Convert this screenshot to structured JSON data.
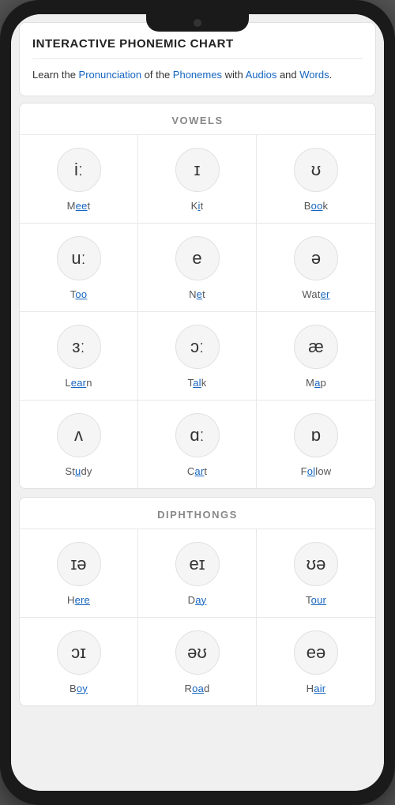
{
  "app": {
    "title": "INTERACTIVE PHONEMIC CHART",
    "subtitle_parts": [
      {
        "text": "Learn the Pronunciation of the Phonemes with Audios and Words.",
        "highlight_words": [
          "Pronunciation",
          "Phonemes",
          "Audios",
          "Words"
        ]
      }
    ],
    "subtitle_display": "Learn the {Pronunciation} of the {Phonemes} with {Audios} and {Words}."
  },
  "sections": [
    {
      "id": "vowels",
      "title": "VOWELS",
      "cells": [
        {
          "symbol": "iː",
          "word_before": "M",
          "word_highlight": "ee",
          "word_after": "t",
          "full_word": "Meet",
          "last_row": false
        },
        {
          "symbol": "ɪ",
          "word_before": "K",
          "word_highlight": "i",
          "word_after": "t",
          "full_word": "Kit",
          "last_row": false
        },
        {
          "symbol": "ʊ",
          "word_before": "B",
          "word_highlight": "oo",
          "word_after": "k",
          "full_word": "Book",
          "last_row": false
        },
        {
          "symbol": "uː",
          "word_before": "T",
          "word_highlight": "oo",
          "word_after": "",
          "full_word": "Too",
          "last_row": false
        },
        {
          "symbol": "e",
          "word_before": "N",
          "word_highlight": "e",
          "word_after": "t",
          "full_word": "Net",
          "last_row": false
        },
        {
          "symbol": "ə",
          "word_before": "Wat",
          "word_highlight": "er",
          "word_after": "",
          "full_word": "Water",
          "last_row": false
        },
        {
          "symbol": "ɜː",
          "word_before": "L",
          "word_highlight": "ear",
          "word_after": "n",
          "full_word": "Learn",
          "last_row": false
        },
        {
          "symbol": "ɔː",
          "word_before": "T",
          "word_highlight": "al",
          "word_after": "k",
          "full_word": "Talk",
          "last_row": false
        },
        {
          "symbol": "æ",
          "word_before": "M",
          "word_highlight": "a",
          "word_after": "p",
          "full_word": "Map",
          "last_row": false
        },
        {
          "symbol": "ʌ",
          "word_before": "St",
          "word_highlight": "u",
          "word_after": "dy",
          "full_word": "Study",
          "last_row": true
        },
        {
          "symbol": "ɑː",
          "word_before": "C",
          "word_highlight": "ar",
          "word_after": "t",
          "full_word": "Cart",
          "last_row": true
        },
        {
          "symbol": "ɒ",
          "word_before": "F",
          "word_highlight": "ol",
          "word_after": "low",
          "full_word": "Follow",
          "last_row": true
        }
      ]
    },
    {
      "id": "diphthongs",
      "title": "DIPHTHONGS",
      "cells": [
        {
          "symbol": "ɪə",
          "word_before": "H",
          "word_highlight": "ere",
          "word_after": "",
          "full_word": "Here",
          "last_row": false
        },
        {
          "symbol": "eɪ",
          "word_before": "D",
          "word_highlight": "ay",
          "word_after": "",
          "full_word": "Day",
          "last_row": false
        },
        {
          "symbol": "ʊə",
          "word_before": "T",
          "word_highlight": "our",
          "word_after": "",
          "full_word": "Tour",
          "last_row": false
        },
        {
          "symbol": "ɔɪ",
          "word_before": "B",
          "word_highlight": "oy",
          "word_after": "",
          "full_word": "Boy",
          "last_row": true
        },
        {
          "symbol": "əʊ",
          "word_before": "R",
          "word_highlight": "oa",
          "word_after": "d",
          "full_word": "Road",
          "last_row": true
        },
        {
          "symbol": "eə",
          "word_before": "H",
          "word_highlight": "air",
          "word_after": "",
          "full_word": "Hair",
          "last_row": true
        }
      ]
    }
  ],
  "colors": {
    "blue": "#1565C0",
    "circle_bg": "#f5f5f5",
    "border": "#e0e0e0",
    "text_gray": "#555",
    "section_title_gray": "#888"
  }
}
